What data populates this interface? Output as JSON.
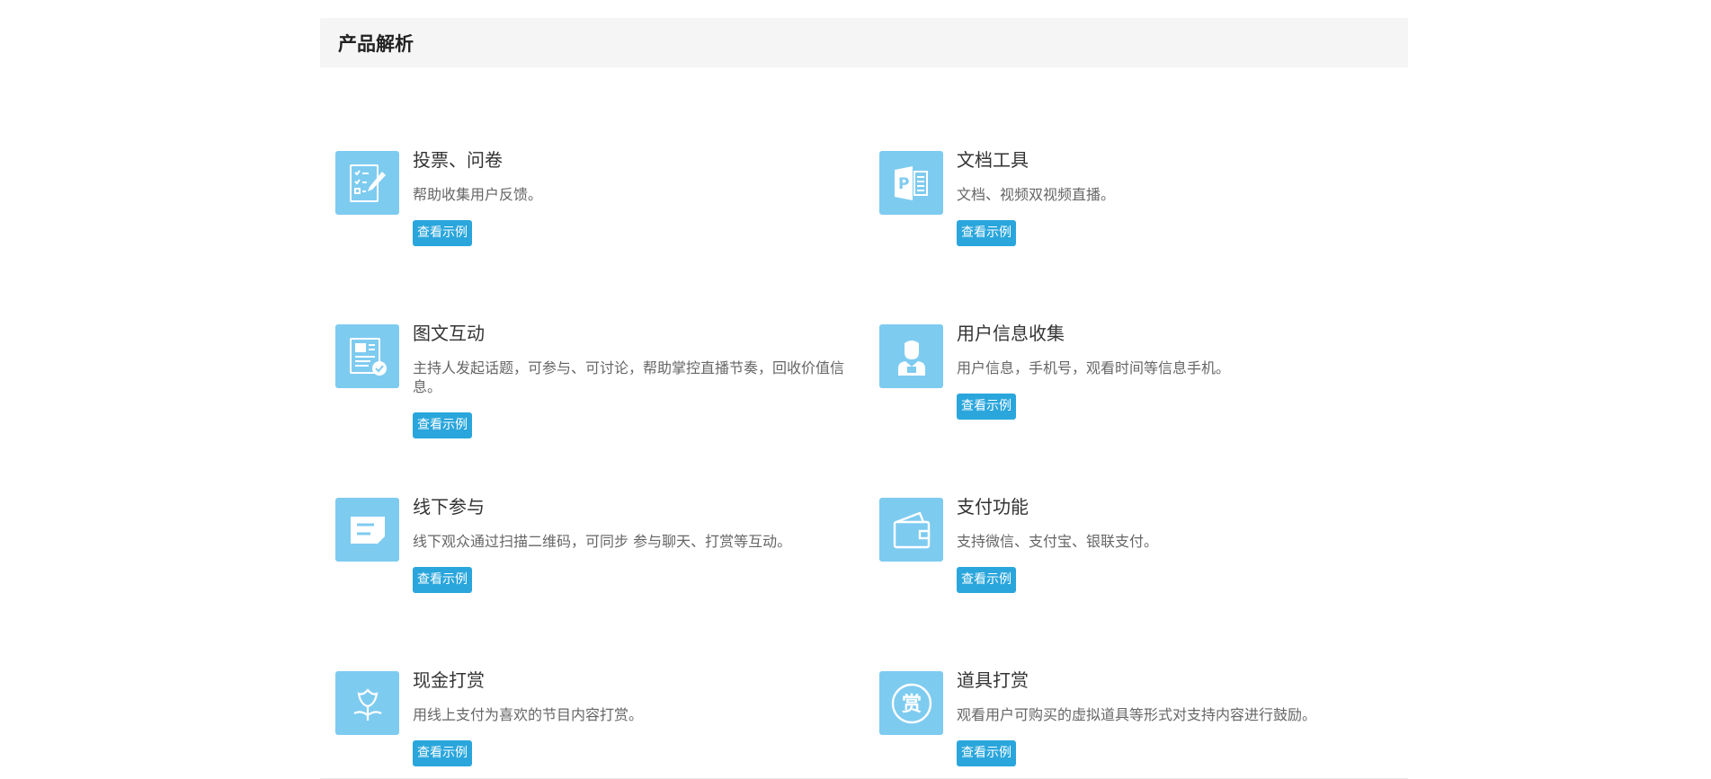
{
  "section": {
    "title": "产品解析"
  },
  "colors": {
    "icon_bg": "#7ecbf0",
    "button_bg": "#2aa6dc",
    "header_bg": "#f5f5f5"
  },
  "features": [
    {
      "title": "投票、问卷",
      "desc": "帮助收集用户反馈。",
      "button": "查看示例",
      "icon": "survey-icon"
    },
    {
      "title": "文档工具",
      "desc": "文档、视频双视频直播。",
      "button": "查看示例",
      "icon": "document-icon"
    },
    {
      "title": "图文互动",
      "desc": "主持人发起话题，可参与、可讨论，帮助掌控直播节奏，回收价值信息。",
      "button": "查看示例",
      "icon": "image-text-icon"
    },
    {
      "title": "用户信息收集",
      "desc": "用户信息，手机号，观看时间等信息手机。",
      "button": "查看示例",
      "icon": "user-icon"
    },
    {
      "title": "线下参与",
      "desc": "线下观众通过扫描二维码，可同步 参与聊天、打赏等互动。",
      "button": "查看示例",
      "icon": "ticket-icon"
    },
    {
      "title": "支付功能",
      "desc": "支持微信、支付宝、银联支付。",
      "button": "查看示例",
      "icon": "wallet-icon"
    },
    {
      "title": "现金打赏",
      "desc": "用线上支付为喜欢的节目内容打赏。",
      "button": "查看示例",
      "icon": "flower-icon"
    },
    {
      "title": "道具打赏",
      "desc": "观看用户可购买的虚拟道具等形式对支持内容进行鼓励。",
      "button": "查看示例",
      "icon": "reward-icon"
    }
  ]
}
